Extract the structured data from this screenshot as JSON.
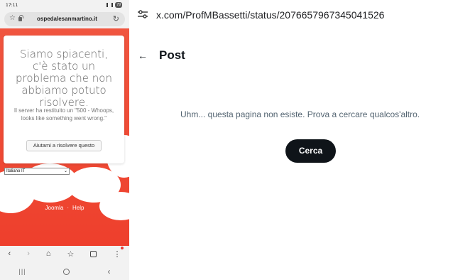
{
  "phone": {
    "status_bar": {
      "time": "17:11",
      "battery": "79"
    },
    "browser": {
      "url": "ospedalesanmartino.it"
    },
    "error_page": {
      "title": "Siamo spiacenti, c'è stato un problema che non abbiamo potuto risolvere.",
      "message": "Il server ha restituito un \"500 - Whoops, looks like something went wrong.\"",
      "help_button": "Aiutami a risolvere questo",
      "language_selected": "Italiano IT",
      "footer_links": [
        "Joomla",
        "Help"
      ]
    }
  },
  "desktop": {
    "address_url": "x.com/ProfMBassetti/status/2076657967345041526",
    "header": {
      "title": "Post"
    },
    "message": "Uhm... questa pagina non esiste. Prova a cercare qualcos'altro.",
    "search_button": "Cerca"
  },
  "colors": {
    "error_background": "#ef4a35",
    "x_button": "#0f1419",
    "secondary_text": "#536471"
  }
}
